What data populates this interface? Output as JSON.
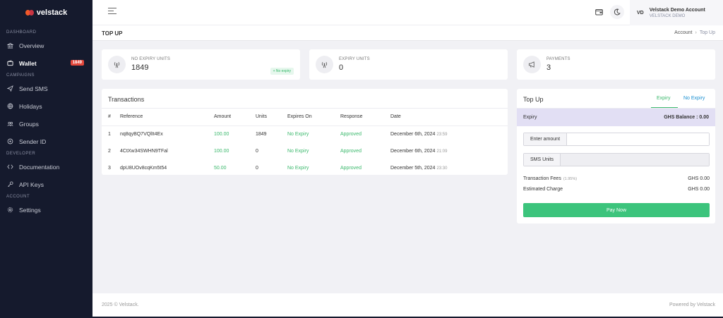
{
  "brand": {
    "name": "velstack"
  },
  "sidebar": {
    "sections": [
      {
        "label": "DASHBOARD",
        "items": [
          {
            "label": "Overview",
            "icon": "bank-icon"
          },
          {
            "label": "Wallet",
            "icon": "wallet-icon",
            "badge": "1849",
            "active": true
          }
        ]
      },
      {
        "label": "CAMPAIGNS",
        "items": [
          {
            "label": "Send SMS",
            "icon": "send-icon"
          },
          {
            "label": "Holidays",
            "icon": "globe-icon"
          },
          {
            "label": "Groups",
            "icon": "users-icon"
          },
          {
            "label": "Sender ID",
            "icon": "target-icon"
          }
        ]
      },
      {
        "label": "DEVELOPER",
        "items": [
          {
            "label": "Documentation",
            "icon": "code-icon"
          },
          {
            "label": "API Keys",
            "icon": "key-icon"
          }
        ]
      },
      {
        "label": "ACCOUNT",
        "items": [
          {
            "label": "Settings",
            "icon": "gear-icon"
          }
        ]
      }
    ]
  },
  "header": {
    "account_initials": "VD",
    "account_name": "Velstack Demo Account",
    "account_sub": "VELSTACK DEMO"
  },
  "page": {
    "title": "TOP UP",
    "breadcrumb": {
      "parent": "Account",
      "current": "Top Up"
    }
  },
  "stats": [
    {
      "label": "NO EXPIRY UNITS",
      "value": "1849",
      "chip": "+ No expiry",
      "icon": "antenna-icon"
    },
    {
      "label": "EXPIRY UNITS",
      "value": "0",
      "icon": "antenna-icon"
    },
    {
      "label": "PAYMENTS",
      "value": "3",
      "icon": "megaphone-icon"
    }
  ],
  "transactions": {
    "title": "Transactions",
    "columns": [
      "#",
      "Reference",
      "Amount",
      "Units",
      "Expires On",
      "Response",
      "Date"
    ],
    "rows": [
      {
        "n": "1",
        "reference": "nq8qyBQ7VQlIt4Ex",
        "amount": "100.00",
        "units": "1849",
        "expires": "No Expiry",
        "response": "Approved",
        "date": "December 6th, 2024",
        "time": "23:59"
      },
      {
        "n": "2",
        "reference": "4CtXw34SWHN9TFal",
        "amount": "100.00",
        "units": "0",
        "expires": "No Expiry",
        "response": "Approved",
        "date": "December 6th, 2024",
        "time": "21:09"
      },
      {
        "n": "3",
        "reference": "dpU8UOv8cqKm5t54",
        "amount": "50.00",
        "units": "0",
        "expires": "No Expiry",
        "response": "Approved",
        "date": "December 5th, 2024",
        "time": "23:30"
      }
    ]
  },
  "topup": {
    "title": "Top Up",
    "tabs": [
      "Expiry",
      "No Expiry"
    ],
    "mode_label": "Expiry",
    "balance": "GHS Balance : 0.00",
    "amount_label": "Enter amount",
    "amount_value": "",
    "units_label": "SMS Units",
    "units_value": "",
    "fees_label": "Transaction Fees",
    "fees_rate": "(1.95%)",
    "fees_value": "GHS 0.00",
    "charge_label": "Estimated Charge",
    "charge_value": "GHS 0.00",
    "pay_label": "Pay Now"
  },
  "footer": {
    "left": "2025 © Velstack.",
    "right": "Powered by Velstack"
  },
  "colors": {
    "sidebar_bg": "#151a2d",
    "accent_green": "#3cc47c",
    "badge_red": "#e4483c",
    "link_blue": "#1a8fd1",
    "balance_bg": "#e2dff4"
  }
}
